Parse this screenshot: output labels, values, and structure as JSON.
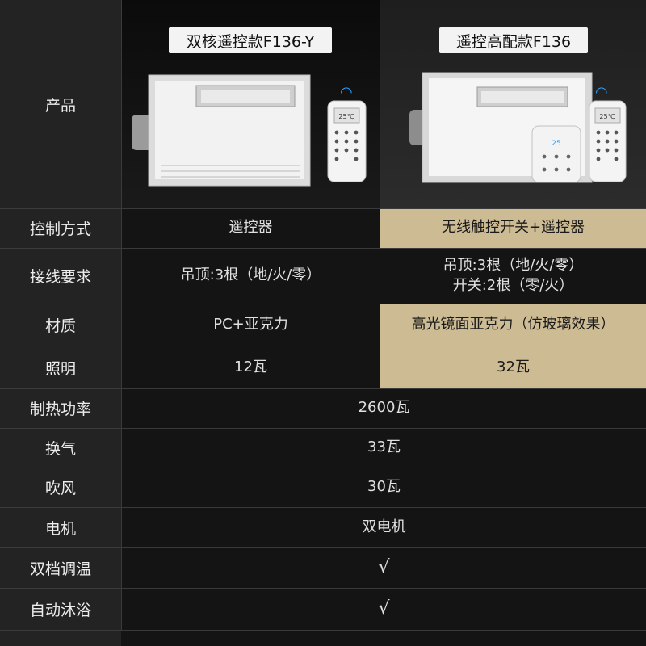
{
  "header": {
    "row_label": "产品",
    "product1_title": "双核遥控款F136-Y",
    "product2_title": "遥控高配款F136"
  },
  "rows": [
    {
      "label": "控制方式",
      "p1": "遥控器",
      "p2": "无线触控开关+遥控器"
    },
    {
      "label": "接线要求",
      "p1": "吊顶:3根（地/火/零）",
      "p2_line1": "吊顶:3根（地/火/零）",
      "p2_line2": "开关:2根（零/火）"
    },
    {
      "label": "材质",
      "p1": "PC+亚克力",
      "p2": "高光镜面亚克力（仿玻璃效果）"
    },
    {
      "label": "照明",
      "p1": "12瓦",
      "p2": "32瓦"
    },
    {
      "label": "制热功率",
      "value": "2600瓦"
    },
    {
      "label": "换气",
      "value": "33瓦"
    },
    {
      "label": "吹风",
      "value": "30瓦"
    },
    {
      "label": "电机",
      "value": "双电机"
    },
    {
      "label": "双档调温",
      "value": "√"
    },
    {
      "label": "自动沐浴",
      "value": "√"
    }
  ],
  "device_text": {
    "remote_display": "25℃",
    "panel_display": "25"
  },
  "colors": {
    "highlight": "#cdbb93",
    "background": "#141414",
    "label_bg": "#232323",
    "wifi": "#2aa0ff"
  }
}
